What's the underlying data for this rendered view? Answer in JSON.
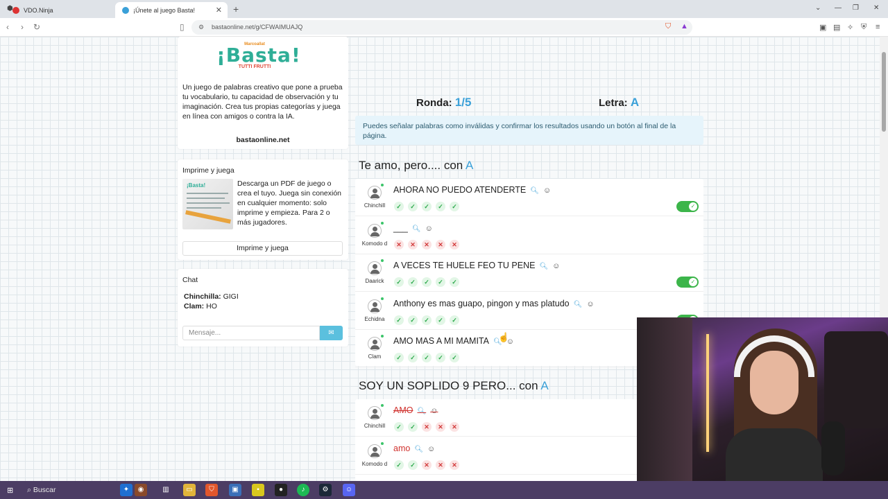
{
  "browser": {
    "tabs": [
      {
        "title": "VDO.Ninja",
        "active": false
      },
      {
        "title": "¡Únete al juego Basta!",
        "active": true
      }
    ],
    "url": "bastaonline.net/g/CFWAIMUAJQ"
  },
  "sidebar": {
    "logo": {
      "top": "Marcoallat",
      "main": "¡Basta!",
      "sub": "TUTTI FRUTTI"
    },
    "description": "Un juego de palabras creativo que pone a prueba tu vocabulario, tu capacidad de observación y tu imaginación. Crea tus propias categorías y juega en línea con amigos o contra la IA.",
    "site": "bastaonline.net",
    "print": {
      "title": "Imprime y juega",
      "thumb_brand": "¡Basta!",
      "text": "Descarga un PDF de juego o crea el tuyo. Juega sin conexión en cualquier momento: solo imprime y empieza. Para 2 o más jugadores.",
      "button": "Imprime y juega"
    },
    "chat": {
      "title": "Chat",
      "messages": [
        {
          "user": "Chinchilla:",
          "text": "GIGI"
        },
        {
          "user": "Clam:",
          "text": "HO"
        }
      ],
      "placeholder": "Mensaje..."
    }
  },
  "game": {
    "round_label": "Ronda:",
    "round_value": "1/5",
    "letter_label": "Letra:",
    "letter_value": "A",
    "info": "Puedes señalar palabras como inválidas y confirmar los resultados usando un botón al final de la página.",
    "categories": [
      {
        "title": "Te amo, pero.... con",
        "letter": "A",
        "answers": [
          {
            "player": "Chinchill",
            "text": "AHORA NO PUEDO ATENDERTE",
            "votes": [
              "yes",
              "yes",
              "yes",
              "yes",
              "yes"
            ],
            "toggle": true
          },
          {
            "player": "Komodo d",
            "text": "___",
            "votes": [
              "no",
              "no",
              "no",
              "no",
              "no"
            ],
            "toggle": false
          },
          {
            "player": "Daarick",
            "text": "A VECES TE HUELE FEO TU PENE",
            "votes": [
              "yes",
              "yes",
              "yes",
              "yes",
              "yes"
            ],
            "toggle": true
          },
          {
            "player": "Echidna",
            "text": "Anthony es mas guapo, pingon y mas platudo",
            "votes": [
              "yes",
              "yes",
              "yes",
              "yes",
              "yes"
            ],
            "toggle": true
          },
          {
            "player": "Clam",
            "text": "AMO MAS A MI MAMITA",
            "votes": [
              "yes",
              "yes",
              "yes",
              "yes",
              "yes"
            ],
            "toggle": false
          }
        ]
      },
      {
        "title": "SOY UN SOPLIDO 9 PERO... con",
        "letter": "A",
        "answers": [
          {
            "player": "Chinchill",
            "text": "AMO",
            "votes": [
              "yes",
              "yes",
              "no",
              "no",
              "no"
            ],
            "invalid": true
          },
          {
            "player": "Komodo d",
            "text": "amo",
            "votes": [
              "yes",
              "yes",
              "no",
              "no",
              "no"
            ],
            "invalid": true
          }
        ]
      }
    ]
  },
  "taskbar": {
    "search": "Buscar"
  }
}
